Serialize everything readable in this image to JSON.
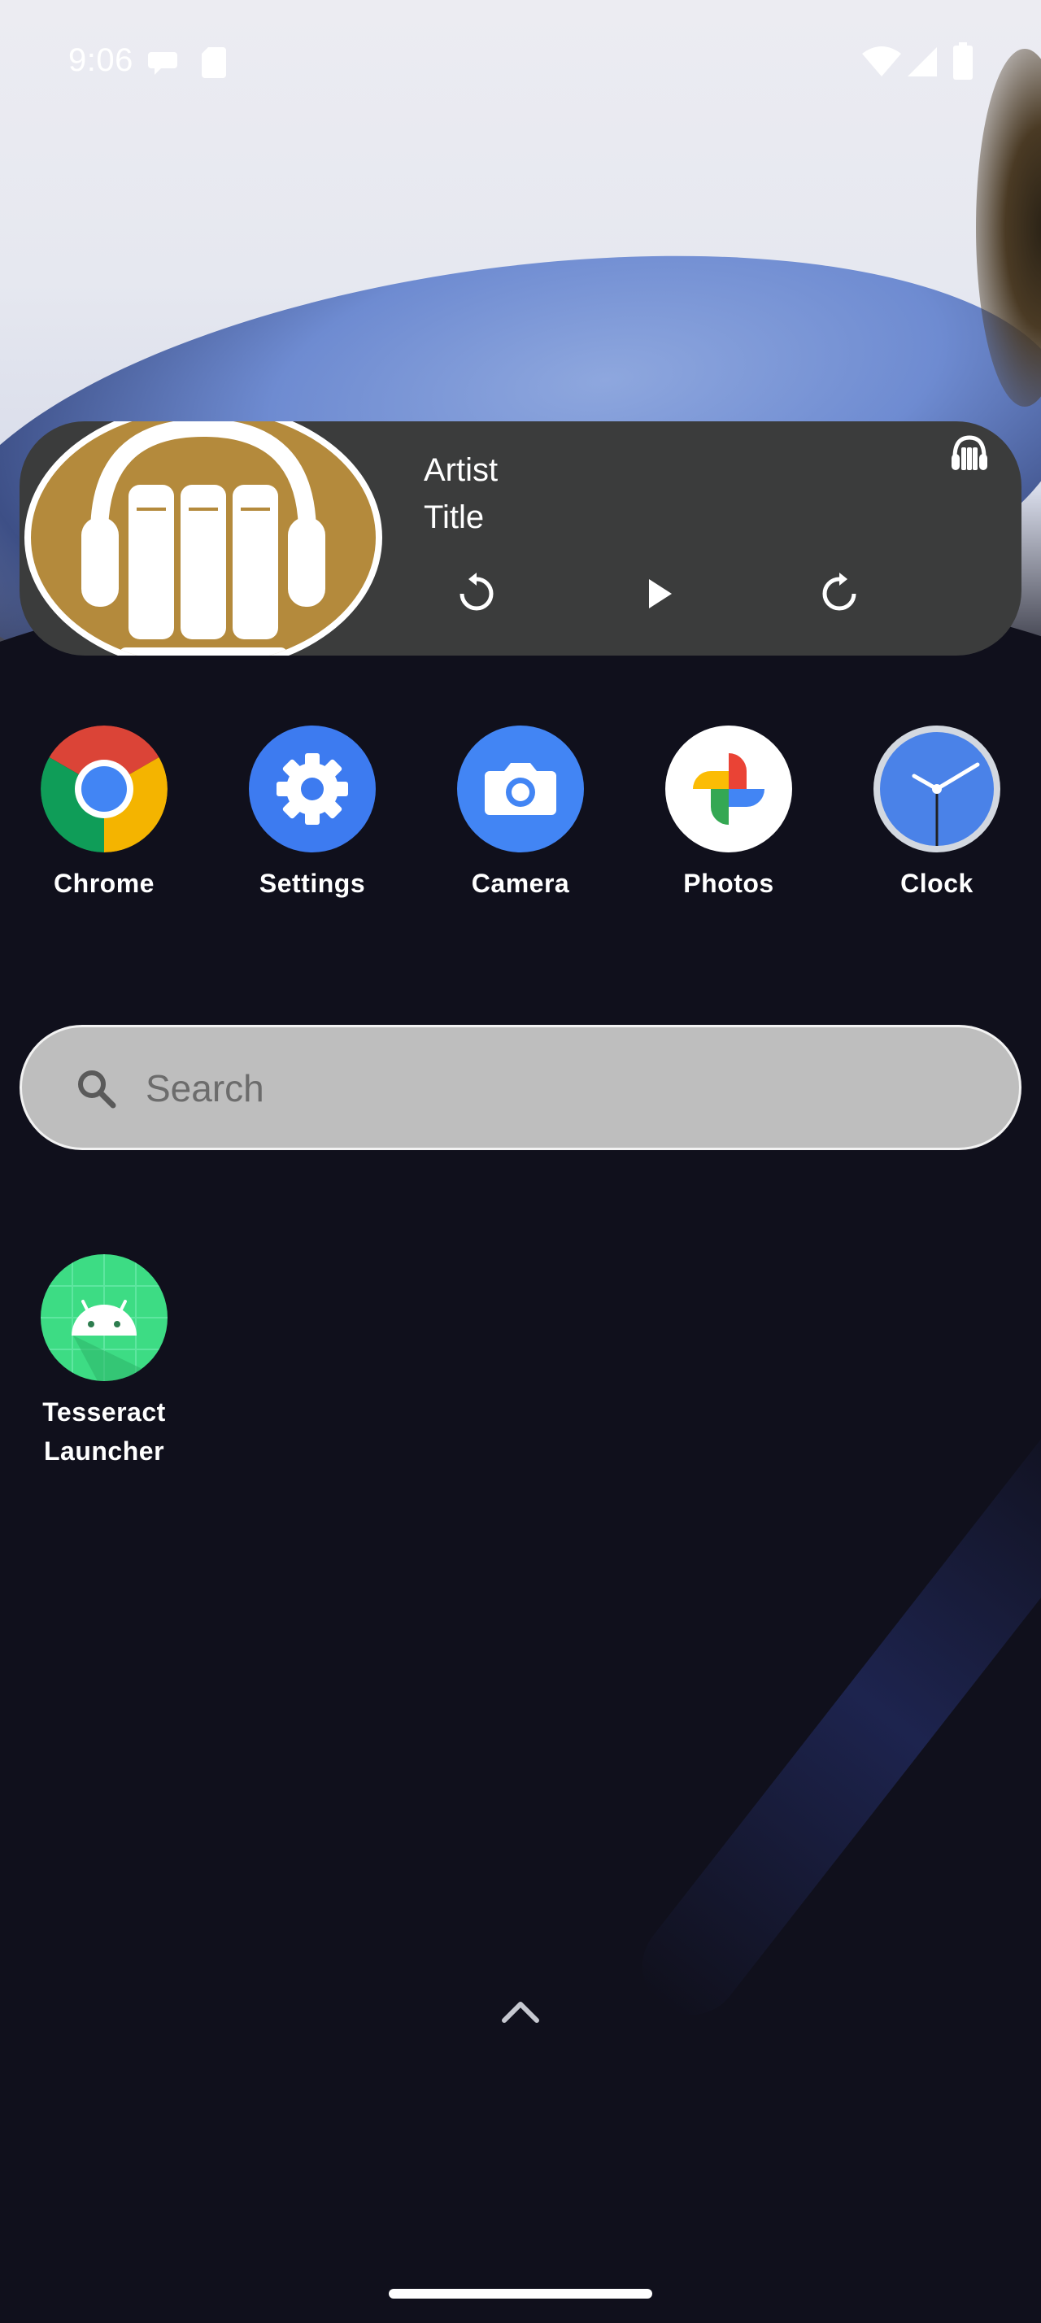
{
  "status_bar": {
    "time": "9:06",
    "left_icons": [
      "chat-bubble-icon",
      "sd-card-icon"
    ],
    "right_icons": [
      "wifi-icon",
      "cellular-signal-icon",
      "battery-icon"
    ]
  },
  "media_widget": {
    "artist": "Artist",
    "title": "Title",
    "controls": [
      "rewind-icon",
      "play-icon",
      "fast-forward-icon"
    ],
    "app_icon": "audiobook-headphones-icon",
    "colors": {
      "background": "#3b3c3c",
      "art": "#b48a3c"
    }
  },
  "apps": [
    {
      "label": "Chrome",
      "icon": "chrome-icon"
    },
    {
      "label": "Settings",
      "icon": "gear-icon"
    },
    {
      "label": "Camera",
      "icon": "camera-icon"
    },
    {
      "label": "Photos",
      "icon": "photos-pinwheel-icon"
    },
    {
      "label": "Clock",
      "icon": "clock-icon"
    }
  ],
  "search": {
    "placeholder": "Search",
    "icon": "search-icon"
  },
  "installed_app": {
    "label_line1": "Tesseract",
    "label_line2": "Launcher",
    "icon": "android-icon"
  },
  "gestures": {
    "app_drawer_hint": "chevron-up-icon",
    "nav_handle": "gesture-handle"
  }
}
